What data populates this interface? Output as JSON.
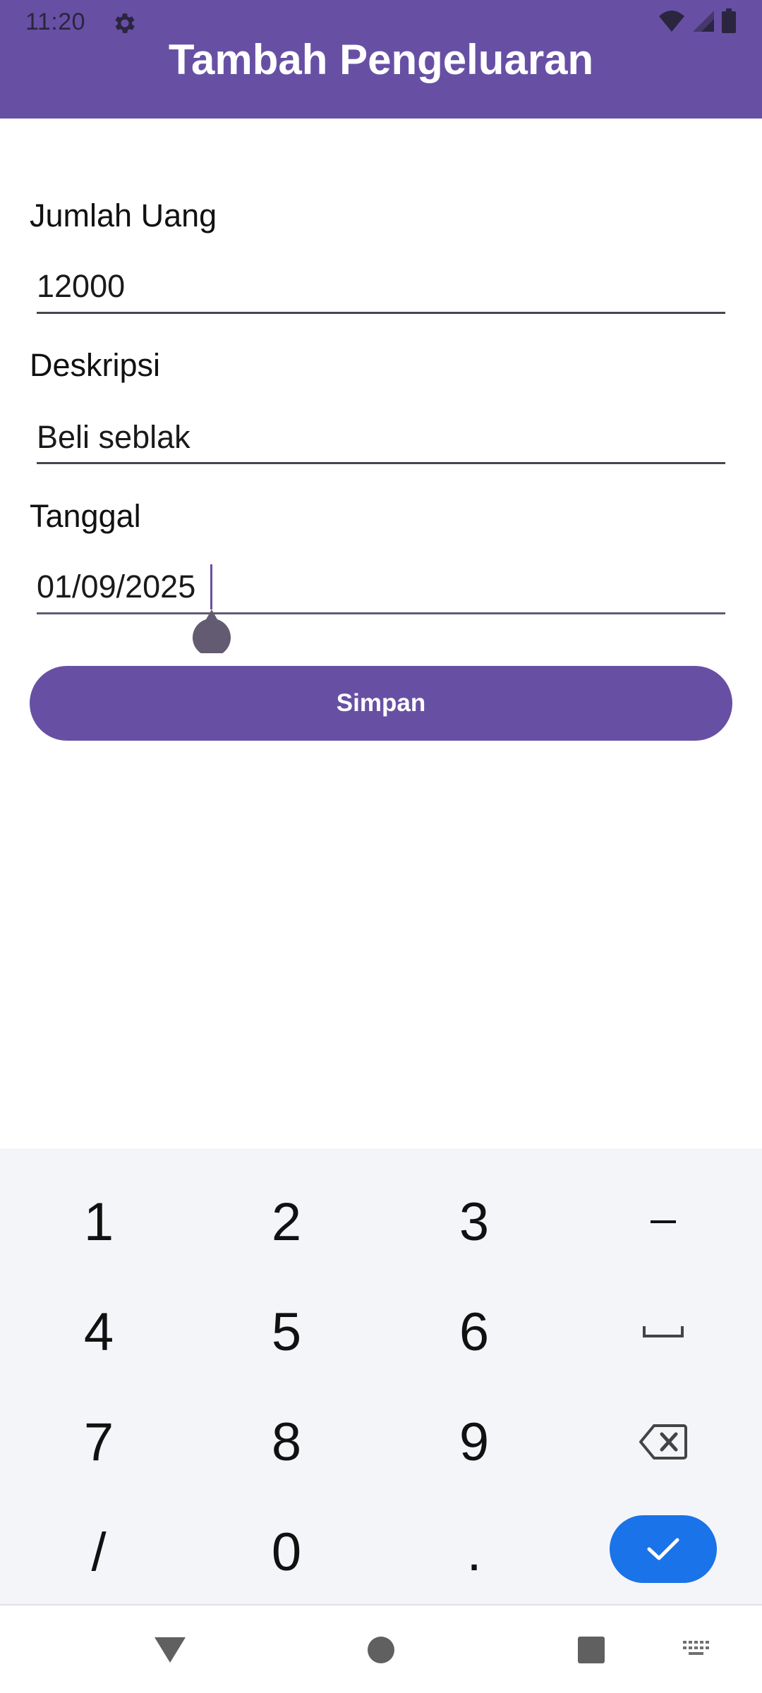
{
  "status_bar": {
    "time": "11:20",
    "icons": [
      "settings-icon",
      "wifi-icon",
      "cellular-icon",
      "battery-icon"
    ]
  },
  "app_bar": {
    "title": "Tambah Pengeluaran",
    "color": "#6750a4"
  },
  "form": {
    "amount": {
      "label": "Jumlah Uang",
      "value": "12000"
    },
    "description": {
      "label": "Deskripsi",
      "value": "Beli seblak"
    },
    "date": {
      "label": "Tanggal",
      "value": "01/09/2025"
    },
    "save_label": "Simpan"
  },
  "keyboard": {
    "keys": [
      "1",
      "2",
      "3",
      "-",
      "4",
      "5",
      "6",
      "space",
      "7",
      "8",
      "9",
      "backspace",
      "/",
      "0",
      ".",
      "done"
    ],
    "key_labels": {
      "k1": "1",
      "k2": "2",
      "k3": "3",
      "minus": "-",
      "k4": "4",
      "k5": "5",
      "k6": "6",
      "k7": "7",
      "k8": "8",
      "k9": "9",
      "slash": "/",
      "k0": "0",
      "dot": "."
    },
    "accent": "#1a73e8"
  },
  "nav_bar": {
    "buttons": [
      "back-icon",
      "home-icon",
      "recents-icon",
      "keyboard-switch-icon"
    ]
  }
}
